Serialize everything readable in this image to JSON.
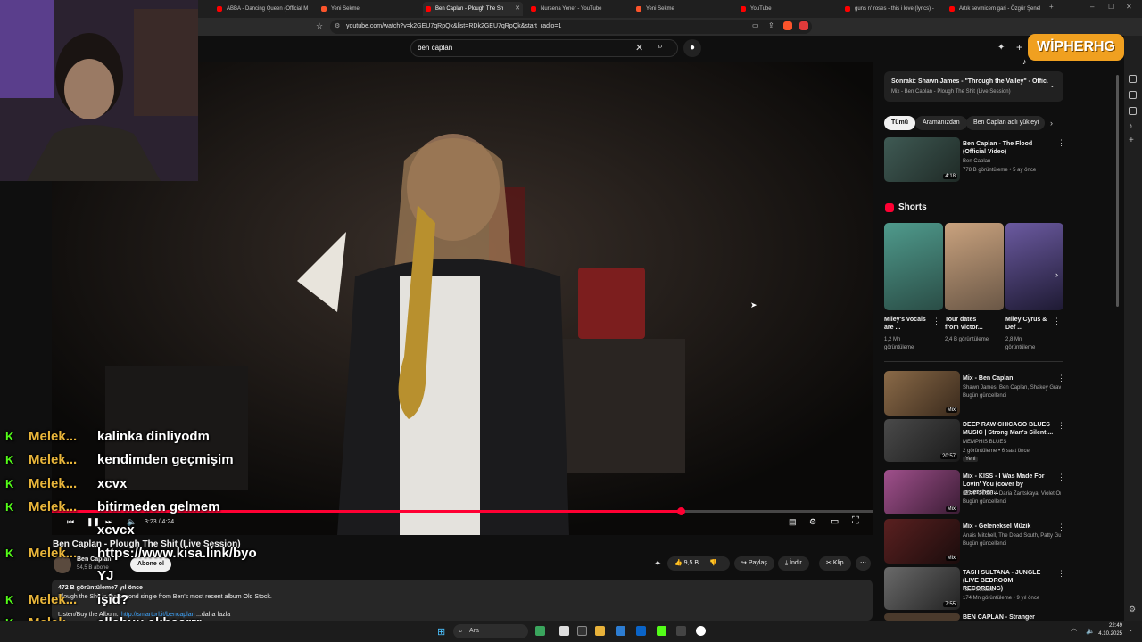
{
  "browser": {
    "tabs": [
      {
        "label": "ABBA - Dancing Queen (Official M",
        "active": false
      },
      {
        "label": "Yeni Sekme",
        "active": false
      },
      {
        "label": "Ben Caplan - Plough The Sh",
        "active": true
      },
      {
        "label": "Nursena Yener - YouTube",
        "active": false
      },
      {
        "label": "Yeni Sekme",
        "active": false
      },
      {
        "label": "YouTube",
        "active": false
      },
      {
        "label": "guns n' roses - this i love (lyrics) -",
        "active": false
      },
      {
        "label": "Artık sevmicem gari - Özgür Şenel",
        "active": false
      }
    ],
    "url": "youtube.com/watch?v=k2GEU7qRpQk&list=RDk2GEU7qRpQk&start_radio=1"
  },
  "search": {
    "query": "ben caplan"
  },
  "overlay": {
    "brand": "WİPHERHG"
  },
  "player": {
    "time": "3:23 / 4:24",
    "progress": 0.766
  },
  "video": {
    "title": "Ben Caplan - Plough The Shit (Live Session)",
    "channel": "Ben Caplan",
    "subscribers": "54,5 B abone",
    "subscribe_label": "Abone ol",
    "likes": "9,5 B",
    "share_label": "Paylaş",
    "download_label": "İndir",
    "clip_label": "Klip",
    "views": "472 B görüntüleme",
    "age": "7 yıl önce",
    "description": "Plough the Shit is the second single from Ben's most recent album Old Stock.",
    "desc_link_label": "Listen/Buy the Album:",
    "desc_link": "http://smarturl.it/bencaplan",
    "more": "...daha fazla"
  },
  "sidebar": {
    "next_label": "Sonraki: Shawn James - \"Through the Valley\" - Offic...",
    "next_sub": "Mix - Ben Caplan - Plough The Shit (Live Session)",
    "chips": [
      "Tümü",
      "Aramanızdan",
      "Ben Caplan adlı yükleyi"
    ],
    "first_item": {
      "title": "Ben Caplan - The Flood (Official Video)",
      "channel": "Ben Caplan",
      "meta": "778 B görüntüleme • 5 ay önce",
      "duration": "4:18"
    },
    "shorts_label": "Shorts",
    "shorts": [
      {
        "title": "Miley's vocals are ...",
        "views": "1,2 Mn görüntüleme"
      },
      {
        "title": "Tour dates from Victor...",
        "views": "2,4 B görüntüleme"
      },
      {
        "title": "Miley Cyrus & Def ...",
        "views": "2,8 Mn görüntüleme"
      }
    ],
    "items": [
      {
        "title": "Mix - Ben Caplan",
        "channel": "Shawn James, Ben Caplan, Shakey Grav...",
        "meta": "Bugün güncellendi",
        "badge": "Mix"
      },
      {
        "title": "DEEP RAW CHICAGO BLUES MUSIC | Strong Man's Silent ...",
        "channel": "MEMPHIS BLUES",
        "meta": "2 görüntüleme • 6 saat önce",
        "extra": "Yeni",
        "duration": "20:57"
      },
      {
        "title": "Mix - KISS - I Was Made For Lovin' You (cover by @Sershen...",
        "channel": "NOAPOLOGY, Daria Zaritskaya, Violet Orl...",
        "meta": "Bugün güncellendi",
        "badge": "Mix"
      },
      {
        "title": "Mix - Geleneksel Müzik",
        "channel": "Anais Mitchell, The Dead South, Patty Gu...",
        "meta": "Bugün güncellendi",
        "badge": "Mix"
      },
      {
        "title": "TASH SULTANA - JUNGLE (LIVE BEDROOM RECORDING)",
        "channel": "Tash Sultana",
        "meta": "174 Mn görüntüleme • 9 yıl önce",
        "duration": "7:55"
      },
      {
        "title": "BEN CAPLAN - Stranger",
        "channel": "",
        "meta": ""
      }
    ]
  },
  "chat": [
    {
      "user": "Melek...",
      "msg": "kalinka dinliyodm"
    },
    {
      "user": "Melek...",
      "msg": "kendimden geçmişim"
    },
    {
      "user": "Melek...",
      "msg": "xcvx"
    },
    {
      "user": "Melek...",
      "msg": "bitirmeden gelmem"
    },
    {
      "user": "",
      "msg": "xcvcx"
    },
    {
      "user": "Melek...",
      "msg": "https://www.kisa.link/byo"
    },
    {
      "user": "",
      "msg": "YJ"
    },
    {
      "user": "Melek...",
      "msg": "işid?"
    },
    {
      "user": "Melek...",
      "msg": "allahuu akbaarrr"
    }
  ],
  "taskbar": {
    "search_label": "Ara",
    "time": "22:49",
    "date": "4.10.2025"
  },
  "colors": {
    "accent_red": "#ff0033",
    "kick_green": "#53fc18",
    "chat_user": "#e8b53a",
    "bg": "#0f0f0f"
  }
}
